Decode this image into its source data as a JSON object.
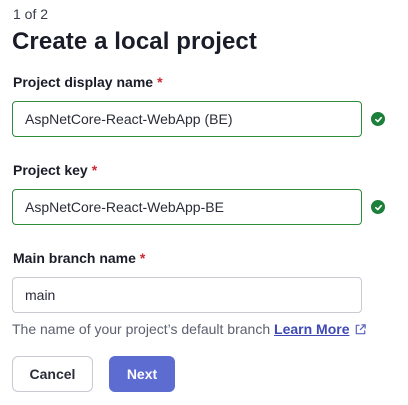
{
  "header": {
    "step": "1 of 2",
    "title": "Create a local project"
  },
  "form": {
    "display_name": {
      "label": "Project display name",
      "required_mark": "*",
      "value": "AspNetCore-React-WebApp (BE)"
    },
    "project_key": {
      "label": "Project key",
      "required_mark": "*",
      "value": "AspNetCore-React-WebApp-BE"
    },
    "main_branch": {
      "label": "Main branch name",
      "required_mark": "*",
      "value": "main",
      "help_text": "The name of your project’s default branch",
      "help_link": "Learn More"
    }
  },
  "actions": {
    "cancel_label": "Cancel",
    "next_label": "Next"
  },
  "colors": {
    "primary": "#5d6cd1",
    "valid": "#1c7f3a",
    "required": "#d0272f",
    "link": "#3e49b4"
  },
  "icons": {
    "valid": "check-circle-icon",
    "external": "external-link-icon"
  }
}
